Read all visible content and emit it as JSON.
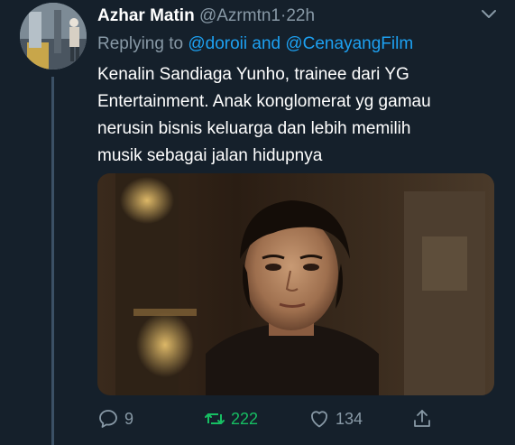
{
  "author": {
    "name": "Azhar Matin",
    "handle": "@Azrmtn1",
    "separator": "·",
    "time": "22h"
  },
  "reply": {
    "prefix": "Replying to",
    "mentions": "@doroii and @CenayangFilm"
  },
  "tweet": {
    "lines": [
      "Kenalin Sandiaga Yunho, trainee dari YG",
      "Entertainment. Anak konglomerat yg gamau",
      "nerusin bisnis keluarga dan lebih memilih",
      "musik sebagai jalan hidupnya"
    ]
  },
  "actions": {
    "reply_count": "9",
    "retweet_count": "222",
    "like_count": "134"
  },
  "colors": {
    "background": "#15202b",
    "secondary_text": "#8899a6",
    "link": "#1da1f2",
    "retweet_active": "#17bf63",
    "thread_line": "#3b5065"
  },
  "icons": {
    "menu": "chevron-down-icon",
    "reply": "reply-icon",
    "retweet": "retweet-icon",
    "like": "heart-icon",
    "share": "share-icon"
  }
}
